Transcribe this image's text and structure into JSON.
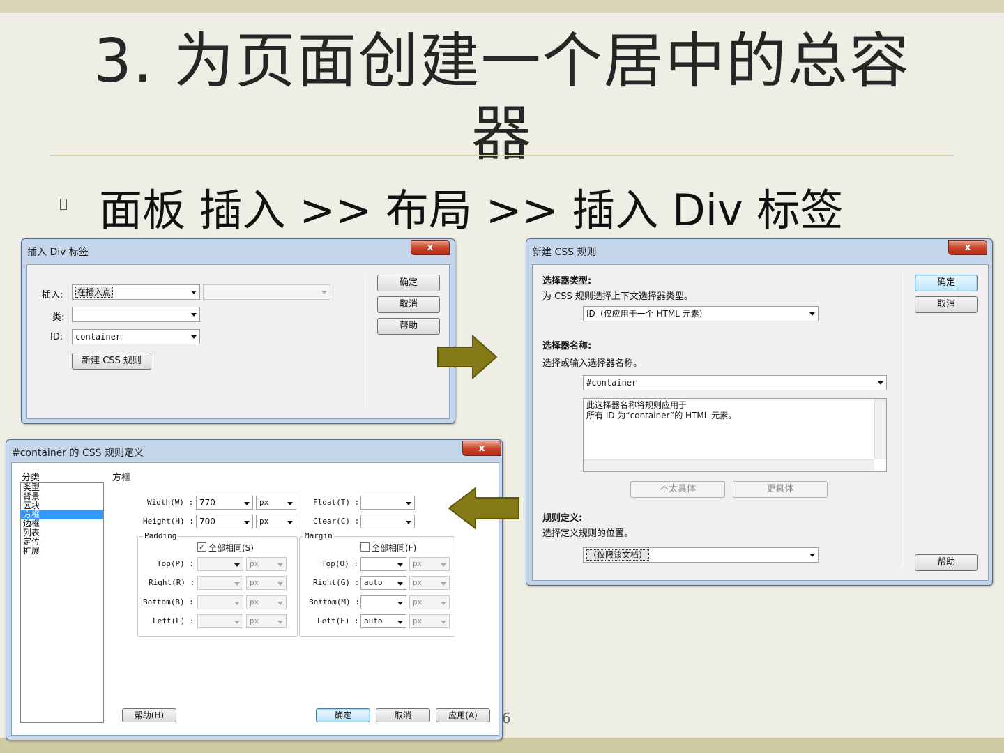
{
  "slide": {
    "title_line1": "3.  为页面创建一个居中的总容",
    "title_line2": "器",
    "bullet": "面板 插入 >> 布局 >> 插入 Div 标签",
    "page_number": "6"
  },
  "colors": {
    "arrow": "#847a16",
    "slide_bg": "#efeee5",
    "window_frame": "#c5d6ea",
    "selection": "#3399ff"
  },
  "insert_div_dialog": {
    "title": "插入 Div 标签",
    "close": "x",
    "insert_label": "插入:",
    "insert_value": "在插入点",
    "insert_second_value": "",
    "class_label": "类:",
    "class_value": "",
    "id_label": "ID:",
    "id_value": "container",
    "new_rule_button": "新建 CSS 规则",
    "ok": "确定",
    "cancel": "取消",
    "help": "帮助"
  },
  "new_css_rule_dialog": {
    "title": "新建 CSS 规则",
    "close": "x",
    "selector_type_heading": "选择器类型:",
    "selector_type_desc": "为 CSS 规则选择上下文选择器类型。",
    "selector_type_value": "ID（仅应用于一个 HTML 元素）",
    "selector_name_heading": "选择器名称:",
    "selector_name_desc": "选择或输入选择器名称。",
    "selector_name_value": "#container",
    "description_line1": "此选择器名称将规则应用于",
    "description_line2": "所有 ID 为“container”的 HTML 元素。",
    "less_specific": "不太具体",
    "more_specific": "更具体",
    "rule_def_heading": "规则定义:",
    "rule_def_desc": "选择定义规则的位置。",
    "rule_def_value": "（仅限该文档）",
    "ok": "确定",
    "cancel": "取消",
    "help": "帮助"
  },
  "css_rule_def_dialog": {
    "title": "#container 的 CSS 规则定义",
    "close": "x",
    "category_header": "分类",
    "categories": [
      "类型",
      "背景",
      "区块",
      "方框",
      "边框",
      "列表",
      "定位",
      "扩展"
    ],
    "selected_category": "方框",
    "panel_header": "方框",
    "width_label": "Width(W) :",
    "width_value": "770",
    "width_unit": "px",
    "height_label": "Height(H) :",
    "height_value": "700",
    "height_unit": "px",
    "float_label": "Float(T) :",
    "float_value": "",
    "clear_label": "Clear(C) :",
    "clear_value": "",
    "padding_legend": "Padding",
    "padding_same_label": "全部相同(S)",
    "padding_same_checked": true,
    "margin_legend": "Margin",
    "margin_same_label": "全部相同(F)",
    "margin_same_checked": false,
    "padding_rows": [
      {
        "label": "Top(P) :",
        "value": "",
        "unit": "px"
      },
      {
        "label": "Right(R) :",
        "value": "",
        "unit": "px"
      },
      {
        "label": "Bottom(B) :",
        "value": "",
        "unit": "px"
      },
      {
        "label": "Left(L) :",
        "value": "",
        "unit": "px"
      }
    ],
    "margin_rows": [
      {
        "label": "Top(O) :",
        "value": "",
        "unit": "px"
      },
      {
        "label": "Right(G) :",
        "value": "auto",
        "unit": "px"
      },
      {
        "label": "Bottom(M) :",
        "value": "",
        "unit": "px"
      },
      {
        "label": "Left(E) :",
        "value": "auto",
        "unit": "px"
      }
    ],
    "help": "帮助(H)",
    "ok": "确定",
    "cancel": "取消",
    "apply": "应用(A)"
  }
}
